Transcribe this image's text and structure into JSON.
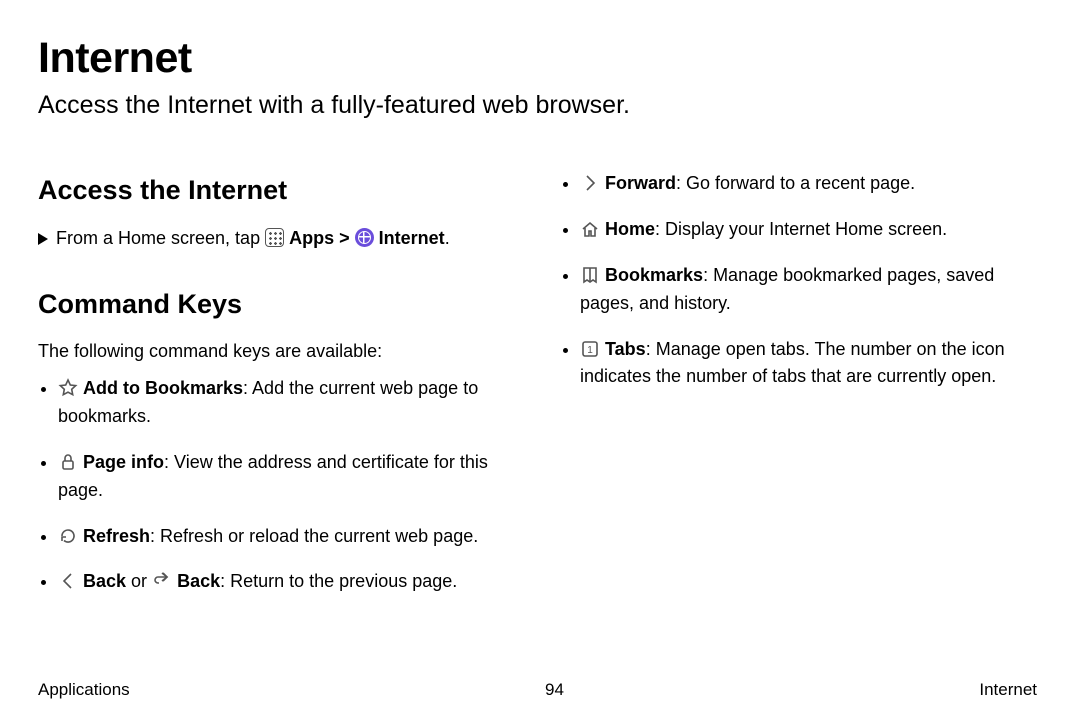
{
  "title": "Internet",
  "subtitle": "Access the Internet with a fully-featured web browser.",
  "section_access": {
    "heading": "Access the Internet",
    "line_prefix": "From a Home screen, tap",
    "apps_label": "Apps",
    "sep": ">",
    "internet_label": "Internet",
    "period": "."
  },
  "section_keys": {
    "heading": "Command Keys",
    "intro": "The following command keys are available:"
  },
  "left_items": [
    {
      "icon": "star",
      "name": "Add to Bookmarks",
      "desc": ": Add the current web page to bookmarks."
    },
    {
      "icon": "lock",
      "name": "Page info",
      "desc": ": View the address and certificate for this page."
    },
    {
      "icon": "refresh",
      "name": "Refresh",
      "desc": ": Refresh or reload the current web page."
    },
    {
      "icon": "back-chevron",
      "name_pre": "Back",
      "or": " or ",
      "icon2": "back-arrow",
      "name": "Back",
      "desc": ": Return to the previous page."
    }
  ],
  "right_items": [
    {
      "icon": "fwd-chevron",
      "name": "Forward",
      "desc": ": Go forward to a recent page."
    },
    {
      "icon": "home",
      "name": "Home",
      "desc": ": Display your Internet Home screen."
    },
    {
      "icon": "bookmarks",
      "name": "Bookmarks",
      "desc": ": Manage bookmarked pages, saved pages, and history."
    },
    {
      "icon": "tabs",
      "name": "Tabs",
      "desc": ": Manage open tabs. The number on the icon indicates the number of tabs that are currently open."
    }
  ],
  "footer": {
    "left": "Applications",
    "center": "94",
    "right": "Internet"
  }
}
